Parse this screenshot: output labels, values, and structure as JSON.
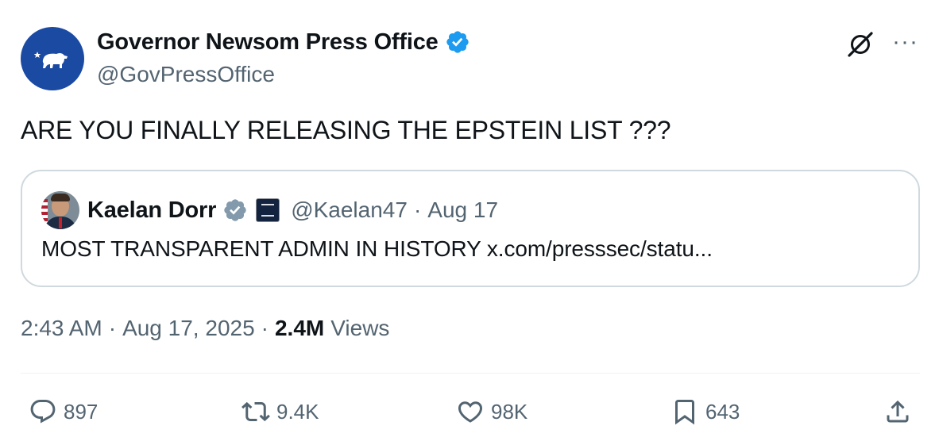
{
  "author": {
    "display_name": "Governor Newsom Press Office",
    "handle": "@GovPressOffice"
  },
  "top_actions": {
    "grok_icon": "grok-icon",
    "more_label": "···"
  },
  "tweet": {
    "text": "ARE YOU FINALLY RELEASING THE EPSTEIN LIST ???"
  },
  "quote": {
    "display_name": "Kaelan Dorr",
    "handle": "@Kaelan47",
    "separator": "·",
    "date": "Aug 17",
    "text": "MOST TRANSPARENT ADMIN IN HISTORY x.com/presssec/statu..."
  },
  "meta": {
    "time": "2:43 AM",
    "separator": "·",
    "date": "Aug 17, 2025",
    "views_count": "2.4M",
    "views_label": "Views"
  },
  "actions": {
    "reply_count": "897",
    "retweet_count": "9.4K",
    "like_count": "98K",
    "bookmark_count": "643"
  },
  "colors": {
    "verified_blue": "#1d9bf0",
    "verified_gray": "#829aab",
    "avatar_blue": "#1b4aa3",
    "secondary_text": "#536471"
  }
}
